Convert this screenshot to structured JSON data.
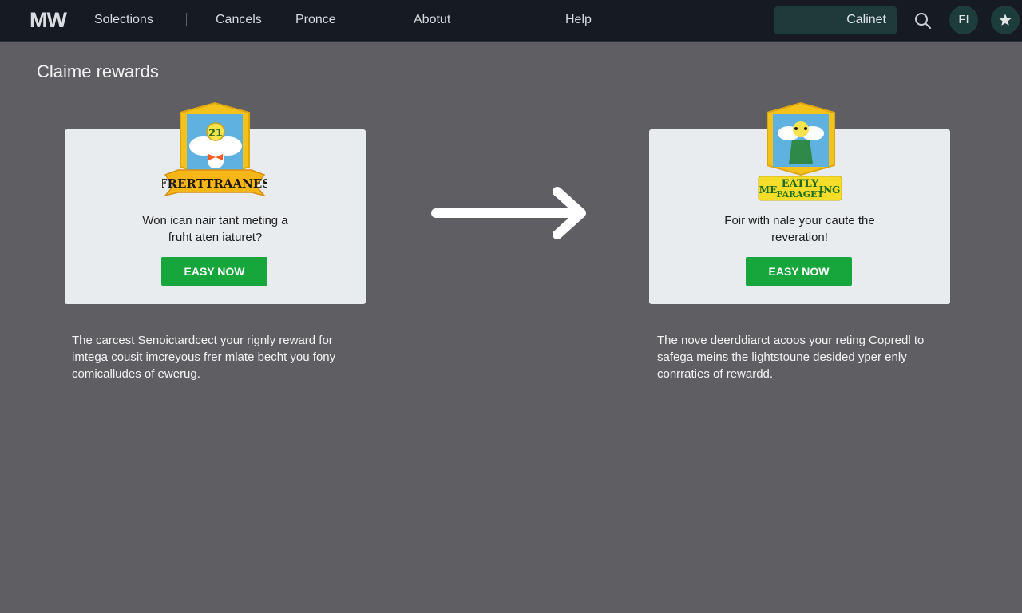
{
  "nav": {
    "logo": "MW",
    "items": [
      "Solections",
      "Cancels",
      "Pronce",
      "Abotut",
      "Help"
    ],
    "user_label": "Calinet",
    "avatar_initials": "FI"
  },
  "page": {
    "title": "Claime rewards"
  },
  "cards": [
    {
      "badge_text": "FRERTTRAANES",
      "badge_number": "21",
      "text_line1": "Won ican nair tant meting a",
      "text_line2": "fruht aten iaturet?",
      "cta": "EASY NOW",
      "desc_line1": "The carcest Senoictardcect your rignly reward for",
      "desc_line2": "imtega cousit imcreyous frer mlate becht you fony",
      "desc_line3": "comicalludes of ewerug."
    },
    {
      "badge_text_top": "EATLY",
      "badge_text_left": "ME",
      "badge_text_right": "ING",
      "badge_text_bottom": "FARAGET",
      "text_line1": "Foir with nale your caute the",
      "text_line2": "reveration!",
      "cta": "EASY NOW",
      "desc_line1": "The nove deerddiarct acoos your reting Copredl to",
      "desc_line2": "safega meins the lightstoune desided yper enly",
      "desc_line3": "conrraties of rewardd."
    }
  ],
  "colors": {
    "background": "#5f5f63",
    "topbar": "#161b22",
    "card": "#e9ecef",
    "cta": "#16a63b",
    "badge_gold": "#f3c21b"
  }
}
